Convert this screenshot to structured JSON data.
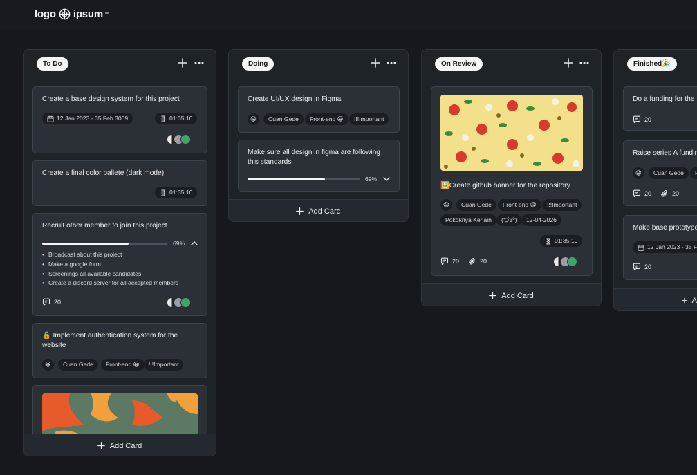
{
  "brand": {
    "logo_left": "logo",
    "logo_right": "ipsum",
    "tm": "™"
  },
  "colors": {
    "background": "#15191e",
    "column": "#1e2328",
    "card": "#2a3036",
    "chip": "#1a1e23",
    "accent_green": "#3fa36b"
  },
  "add_card_label": "Add Card",
  "columns": [
    {
      "title": "To Do",
      "cards": [
        {
          "title": "Create a base design system for this project",
          "date": "12 Jan 2023 - 35 Feb 3069",
          "timer": "01:35:10"
        },
        {
          "title": "Create a final color pallete (dark mode)",
          "timer": "01:35:10"
        },
        {
          "title": "Recruit other member to join this project",
          "progress": 0.69,
          "progress_label": "69%",
          "checklist": [
            "Broadcast about this project",
            "Make a google form",
            "Screenings all available candidates",
            "Create a discord server for all accepted members"
          ],
          "comments": "20"
        },
        {
          "title": "🔒 Implement authentication system for the website",
          "tags": [
            "😀",
            "Cuan Gede",
            "Front-end 😀",
            "!!!Important"
          ]
        }
      ]
    },
    {
      "title": "Doing",
      "cards": [
        {
          "title": "Create UI/UX design in Figma",
          "tags": [
            "😀",
            "Cuan Gede",
            "Front-end 😀",
            "!!!Important"
          ]
        },
        {
          "title": "Make sure all design in figma are following this standards",
          "progress": 0.69,
          "progress_label": "69%"
        }
      ]
    },
    {
      "title": "On Review",
      "cards": [
        {
          "title": "🖼️Create github banner for the repository",
          "tags": [
            "😀",
            "Cuan Gede",
            "Front-end 😀",
            "!!!Important"
          ],
          "tags_row2": [
            "Pokoknya Kerjain",
            "(づ3⁰)",
            "12-04-2026"
          ],
          "timer": "01:35:10",
          "comments": "20",
          "attachments": "20"
        }
      ]
    },
    {
      "title": "Finished🎉",
      "cards": [
        {
          "title": "Do a funding for the p",
          "comments": "20"
        },
        {
          "title": "Raise series A fundin",
          "tags": [
            "😀",
            "Cuan Gede",
            "F"
          ],
          "comments": "20",
          "attachments": "20"
        },
        {
          "title": "Make base prototype",
          "date": "12 Jan 2023 - 35 F",
          "comments": "20"
        }
      ]
    }
  ],
  "finished_add_partial": "A"
}
